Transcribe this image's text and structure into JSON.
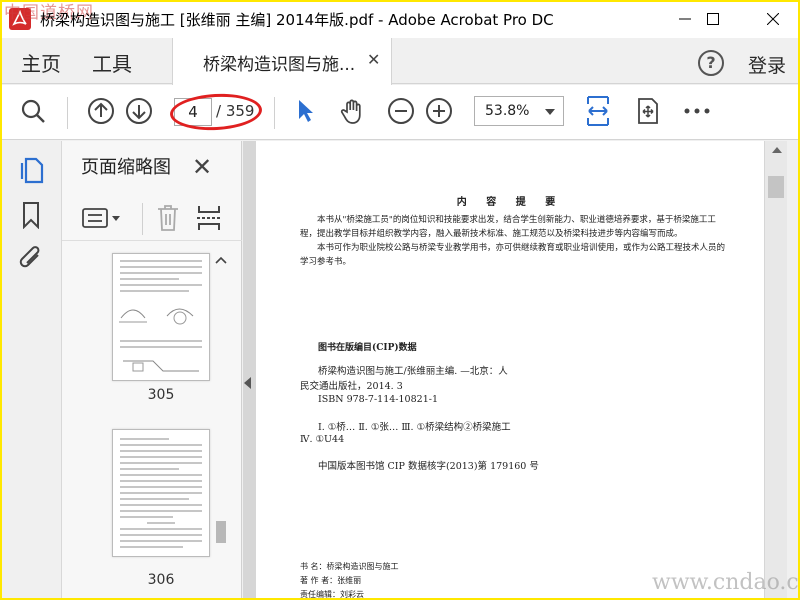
{
  "window": {
    "title": "桥梁构造识图与施工 [张维丽 主编] 2014年版.pdf - Adobe Acrobat Pro DC",
    "watermark_top": "中国道桥网"
  },
  "tabs": {
    "home": "主页",
    "tools": "工具",
    "document": "桥梁构造识图与施...",
    "help": "?",
    "login": "登录"
  },
  "toolbar": {
    "current_page": "4",
    "total_pages": "/ 359",
    "zoom": "53.8%"
  },
  "thumbnails": {
    "title": "页面缩略图",
    "pages": [
      {
        "label": "305"
      },
      {
        "label": "306"
      }
    ]
  },
  "document": {
    "heading": "内 容 提 要",
    "para1": "本书从\"桥梁施工员\"的岗位知识和技能要求出发，结合学生创新能力、职业道德培养要求，基于桥梁施工工程，提出教学目标并组织教学内容，融入最新技术标准、施工规范以及桥梁科技进步等内容编写而成。",
    "para2": "本书可作为职业院校公路与桥梁专业教学用书，亦可供继续教育或职业培训使用，或作为公路工程技术人员的学习参考书。",
    "cip_title": "图书在版编目(CIP)数据",
    "cip_line1": "桥梁构造识图与施工/张维丽主编. —北京：人",
    "cip_line2": "民交通出版社，2014. 3",
    "isbn": "ISBN  978-7-114-10821-1",
    "class_line1": "Ⅰ. ①桥…  Ⅱ. ①张…  Ⅲ. ①桥梁结构②桥梁施工",
    "class_line2": "Ⅳ. ①U44",
    "cip_no": "中国版本图书馆 CIP 数据核字(2013)第 179160 号",
    "book_title": "书    名：桥梁构造识图与施工",
    "author": "著 作 者：张维丽",
    "editor": "责任编辑：刘彩云"
  },
  "watermark_bottom": "www.cndao.com",
  "colors": {
    "accent": "#2c6fd0",
    "highlight": "#e02020",
    "frame": "#ffe800"
  }
}
